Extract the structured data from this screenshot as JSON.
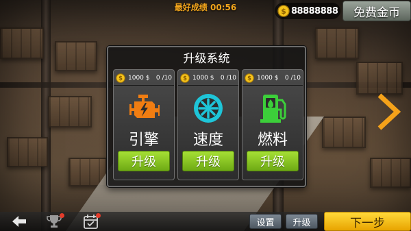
{
  "hud": {
    "best_label": "最好成绩",
    "best_time": "00:56",
    "coins": "88888888",
    "free_coins_label": "免费金币"
  },
  "panel": {
    "title": "升级系统",
    "cards": [
      {
        "name": "引擎",
        "cost": "1000 $",
        "level": "0 /10",
        "upgrade_label": "升级",
        "icon": "engine-icon"
      },
      {
        "name": "速度",
        "cost": "1000 $",
        "level": "0 /10",
        "upgrade_label": "升级",
        "icon": "wheel-icon"
      },
      {
        "name": "燃料",
        "cost": "1000 $",
        "level": "0 /10",
        "upgrade_label": "升级",
        "icon": "fuel-pump-icon"
      }
    ]
  },
  "bottom": {
    "back_icon": "back-arrow-icon",
    "trophy_icon": "trophy-icon",
    "calendar_icon": "calendar-icon",
    "settings_label": "设置",
    "upgrade_label": "升级",
    "next_label": "下一步"
  },
  "colors": {
    "accent_orange": "#f2a51c",
    "upgrade_green": "#8cc924",
    "next_yellow": "#f7c51d",
    "wheel_cyan": "#1ec5d8",
    "fuel_green": "#3ccf3a"
  }
}
